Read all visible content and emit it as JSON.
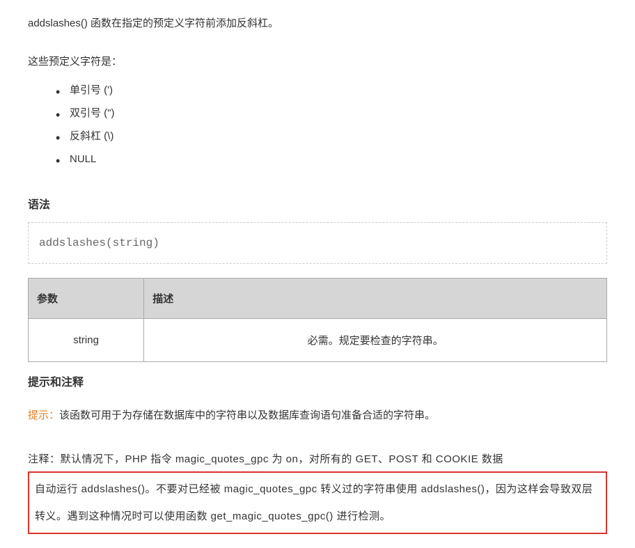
{
  "intro": "addslashes() 函数在指定的预定义字符前添加反斜杠。",
  "chars_label": "这些预定义字符是：",
  "chars": [
    "单引号 (')",
    "双引号 (\")",
    "反斜杠 (\\)",
    "NULL"
  ],
  "syntax_heading": "语法",
  "syntax_code": "addslashes(string)",
  "table": {
    "headers": [
      "参数",
      "描述"
    ],
    "rows": [
      [
        "string",
        "必需。规定要检查的字符串。"
      ]
    ]
  },
  "tips_heading": "提示和注释",
  "tip_label": "提示：",
  "tip_text": "该函数可用于为存储在数据库中的字符串以及数据库查询语句准备合适的字符串。",
  "note_label": "注释：",
  "note_lead": "默认情况下，PHP 指令 magic_quotes_gpc 为 on，对所有的 GET、POST 和 COOKIE 数据",
  "note_boxed": "自动运行 addslashes()。不要对已经被 magic_quotes_gpc 转义过的字符串使用 addslashes()，因为这样会导致双层转义。遇到这种情况时可以使用函数 get_magic_quotes_gpc() 进行检测。"
}
